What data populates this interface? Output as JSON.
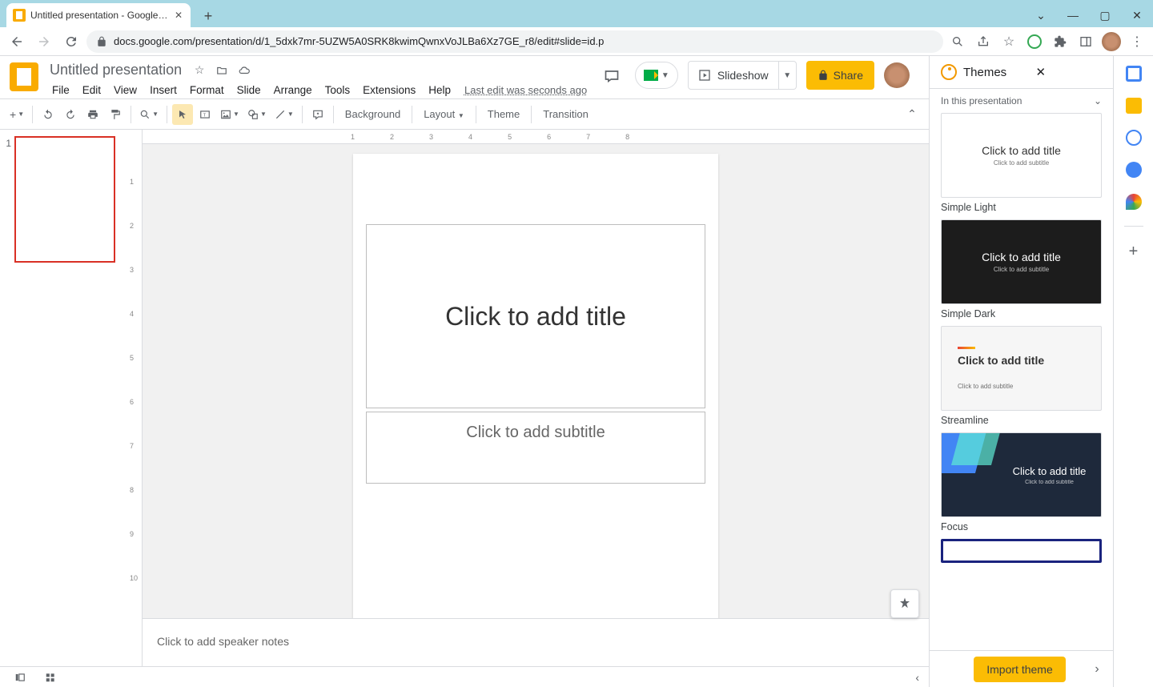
{
  "browser": {
    "tab_title": "Untitled presentation - Google Slides",
    "url": "docs.google.com/presentation/d/1_5dxk7mr-5UZW5A0SRK8kwimQwnxVoJLBa6Xz7GE_r8/edit#slide=id.p"
  },
  "header": {
    "doc_title": "Untitled presentation",
    "last_edit": "Last edit was seconds ago",
    "slideshow_label": "Slideshow",
    "share_label": "Share"
  },
  "menus": [
    "File",
    "Edit",
    "View",
    "Insert",
    "Format",
    "Slide",
    "Arrange",
    "Tools",
    "Extensions",
    "Help"
  ],
  "toolbar": {
    "background": "Background",
    "layout": "Layout",
    "theme": "Theme",
    "transition": "Transition"
  },
  "slide": {
    "title_placeholder": "Click to add title",
    "subtitle_placeholder": "Click to add subtitle",
    "speaker_notes_placeholder": "Click to add speaker notes"
  },
  "thumbnails": [
    {
      "number": "1"
    }
  ],
  "themes_panel": {
    "title": "Themes",
    "section": "In this presentation",
    "import_label": "Import theme",
    "items": [
      {
        "name": "Simple Light",
        "variant": "light"
      },
      {
        "name": "Simple Dark",
        "variant": "dark"
      },
      {
        "name": "Streamline",
        "variant": "stream"
      },
      {
        "name": "Focus",
        "variant": "focus"
      }
    ],
    "preview_title": "Click to add title",
    "preview_sub": "Click to add subtitle"
  },
  "ruler_h": [
    "1",
    "2",
    "3",
    "4",
    "5",
    "6",
    "7",
    "8"
  ],
  "ruler_v": [
    "1",
    "2",
    "3",
    "4",
    "5",
    "6",
    "7",
    "8",
    "9",
    "10"
  ]
}
